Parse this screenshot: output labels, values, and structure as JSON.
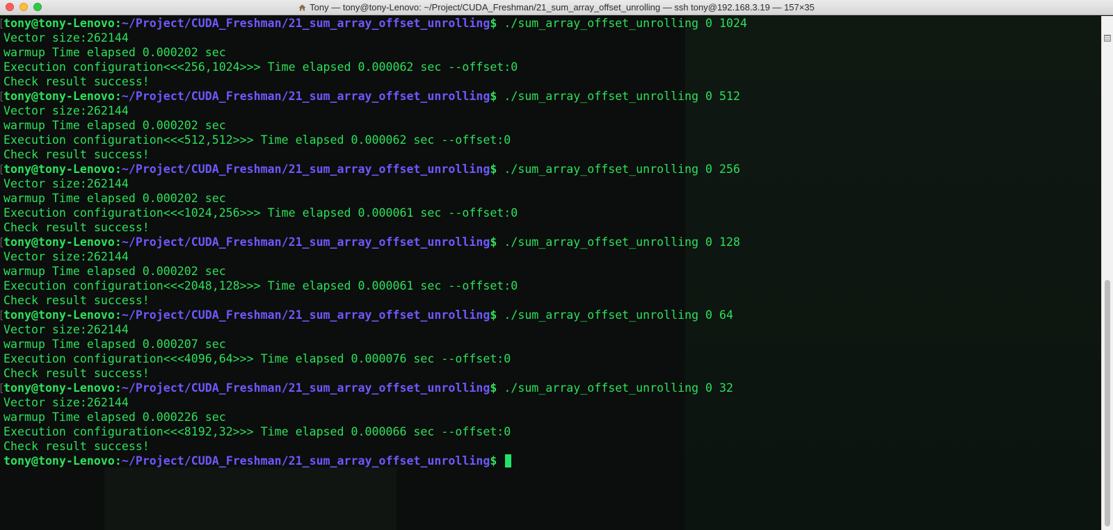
{
  "window": {
    "title": "Tony — tony@tony-Lenovo: ~/Project/CUDA_Freshman/21_sum_array_offset_unrolling — ssh tony@192.168.3.19 — 157×35",
    "title_icon": "home-icon"
  },
  "colors": {
    "prompt_user": "#2ee05c",
    "prompt_path": "#6e58ff",
    "output": "#2ee05c",
    "cursor": "#22e36a",
    "background": "#0b0e0c"
  },
  "terminal": {
    "prompt_user": "tony@tony-Lenovo:",
    "prompt_path": "~/Project/CUDA_Freshman/21_sum_array_offset_unrolling",
    "prompt_symbol": "$",
    "sessions": [
      {
        "command": "./sum_array_offset_unrolling 0 1024",
        "output": [
          "Vector size:262144",
          "warmup Time elapsed 0.000202 sec",
          "Execution configuration<<<256,1024>>> Time elapsed 0.000062 sec --offset:0",
          "Check result success!"
        ]
      },
      {
        "command": "./sum_array_offset_unrolling 0 512",
        "output": [
          "Vector size:262144",
          "warmup Time elapsed 0.000202 sec",
          "Execution configuration<<<512,512>>> Time elapsed 0.000062 sec --offset:0",
          "Check result success!"
        ]
      },
      {
        "command": "./sum_array_offset_unrolling 0 256",
        "output": [
          "Vector size:262144",
          "warmup Time elapsed 0.000202 sec",
          "Execution configuration<<<1024,256>>> Time elapsed 0.000061 sec --offset:0",
          "Check result success!"
        ]
      },
      {
        "command": "./sum_array_offset_unrolling 0 128",
        "output": [
          "Vector size:262144",
          "warmup Time elapsed 0.000202 sec",
          "Execution configuration<<<2048,128>>> Time elapsed 0.000061 sec --offset:0",
          "Check result success!"
        ]
      },
      {
        "command": "./sum_array_offset_unrolling 0 64",
        "output": [
          "Vector size:262144",
          "warmup Time elapsed 0.000207 sec",
          "Execution configuration<<<4096,64>>> Time elapsed 0.000076 sec --offset:0",
          "Check result success!"
        ]
      },
      {
        "command": "./sum_array_offset_unrolling 0 32",
        "output": [
          "Vector size:262144",
          "warmup Time elapsed 0.000226 sec",
          "Execution configuration<<<8192,32>>> Time elapsed 0.000066 sec --offset:0",
          "Check result success!"
        ]
      }
    ],
    "current_command": ""
  }
}
